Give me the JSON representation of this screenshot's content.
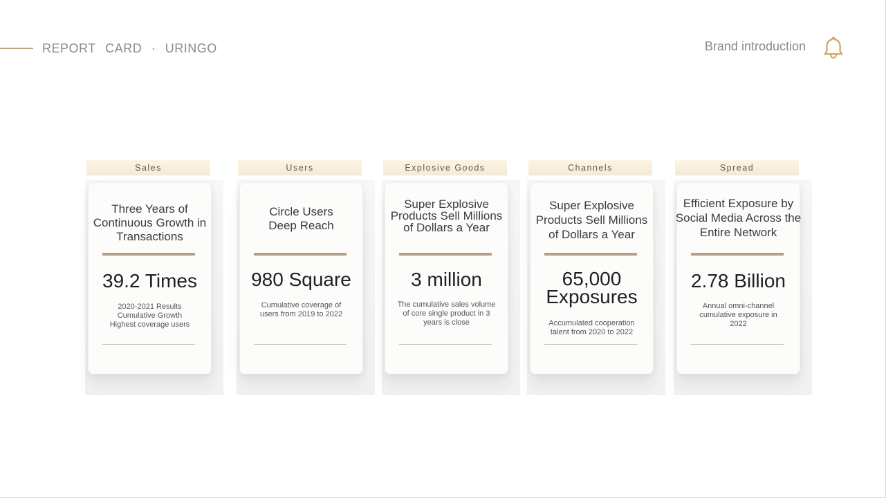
{
  "header": {
    "title_part1": "REPORT",
    "title_part2": "CARD",
    "title_sep": "·",
    "title_part3": "URINGO",
    "brand_link": "Brand introduction",
    "bell_icon": "bell-icon",
    "accent_color": "#c9a55a"
  },
  "cards": [
    {
      "tab": "Sales",
      "heading": "Three Years of Continuous Growth in Transactions",
      "metric": "39.2 Times",
      "description": "2020-2021 Results Cumulative Growth Highest coverage users"
    },
    {
      "tab": "Users",
      "heading": "Circle Users Deep Reach",
      "metric": "980 Square",
      "description": "Cumulative coverage of users from 2019 to 2022"
    },
    {
      "tab": "Explosive Goods",
      "heading": "Super Explosive Products Sell Millions of Dollars a Year",
      "metric": "3 million",
      "description": "The cumulative sales volume of core single product in 3 years is close"
    },
    {
      "tab": "Channels",
      "heading": "Super Explosive Products Sell Millions of Dollars a Year",
      "metric": "65,000 Exposures",
      "description": "Accumulated cooperation talent from 2020 to 2022"
    },
    {
      "tab": "Spread",
      "heading": "Efficient Exposure by Social Media Across the Entire Network",
      "metric": "2.78 Billion",
      "description": "Annual omni-channel cumulative exposure in 2022"
    }
  ]
}
